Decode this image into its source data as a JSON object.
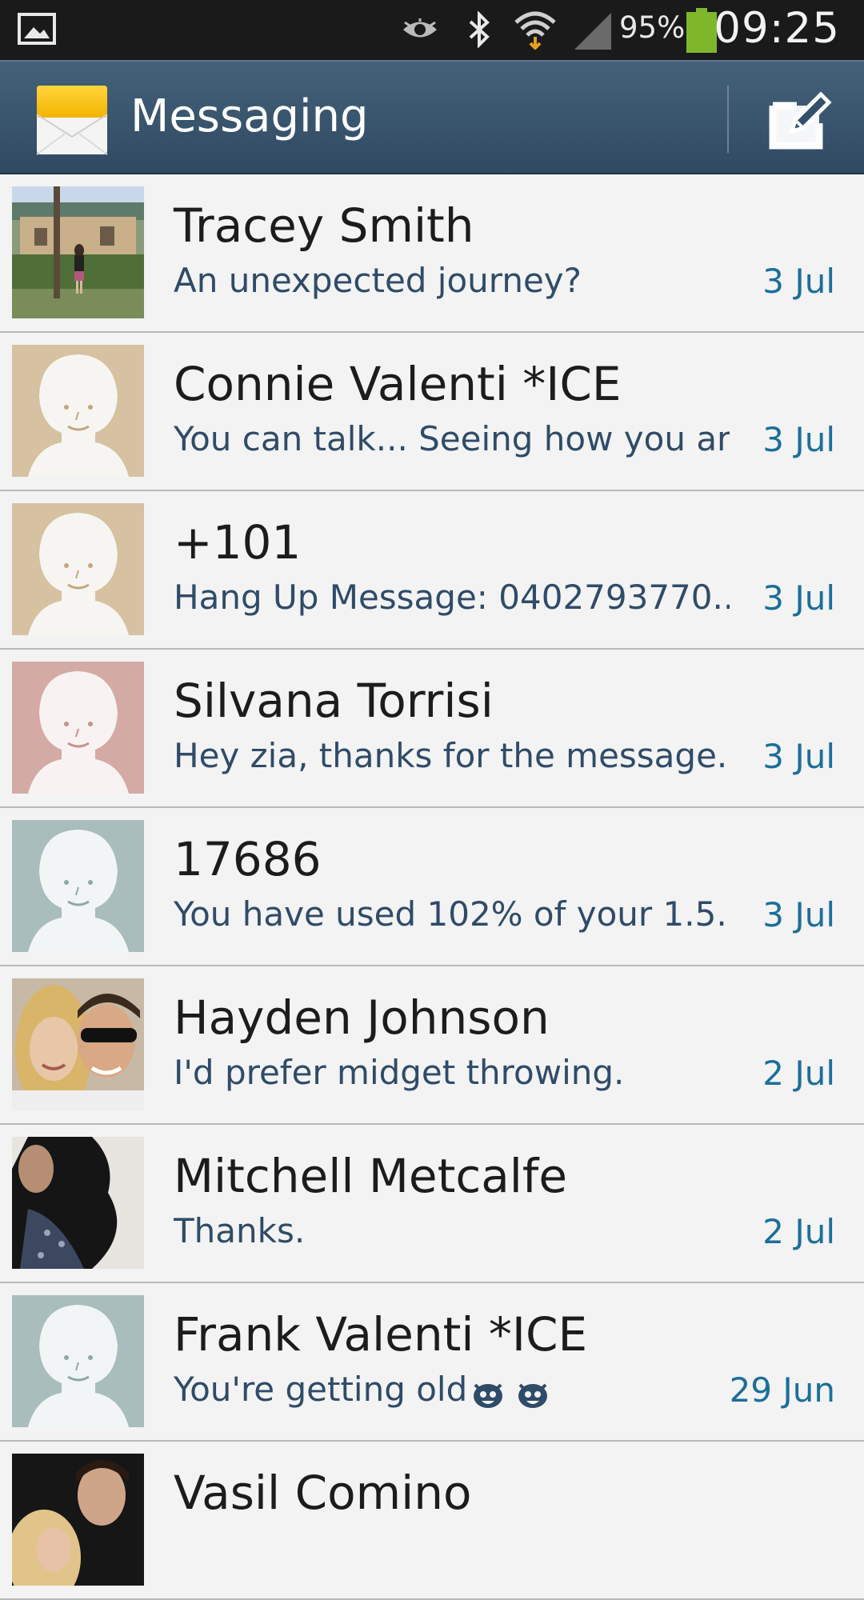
{
  "status_bar": {
    "battery_percent": "95%",
    "battery_level": 0.95,
    "time": "09:25",
    "icons": [
      "gallery-notification-icon",
      "eye-icon",
      "bluetooth-icon",
      "wifi-icon",
      "signal-icon",
      "battery-icon"
    ]
  },
  "action_bar": {
    "title": "Messaging",
    "app_icon": "envelope-icon",
    "compose_icon": "compose-icon"
  },
  "conversations": [
    {
      "name": "Tracey Smith",
      "preview": "An unexpected journey?",
      "date": "3 Jul",
      "avatar": "photo"
    },
    {
      "name": "Connie Valenti *ICE",
      "preview": "You can talk... Seeing how you ar...",
      "date": "3 Jul",
      "avatar": "default",
      "avatar_color": "#d6c1a1"
    },
    {
      "name": "+101",
      "preview": "Hang Up Message: 0402793770...",
      "date": "3 Jul",
      "avatar": "default",
      "avatar_color": "#d6c1a1"
    },
    {
      "name": "Silvana Torrisi",
      "preview": "Hey zia, thanks for the message....",
      "date": "3 Jul",
      "avatar": "default",
      "avatar_color": "#d3aaa4"
    },
    {
      "name": "17686",
      "preview": "You have used 102% of your 1.5...",
      "date": "3 Jul",
      "avatar": "default",
      "avatar_color": "#a8bdbc"
    },
    {
      "name": "Hayden Johnson",
      "preview": "I'd prefer midget throwing.",
      "date": "2 Jul",
      "avatar": "photo"
    },
    {
      "name": "Mitchell Metcalfe",
      "preview": "Thanks.",
      "date": "2 Jul",
      "avatar": "photo"
    },
    {
      "name": "Frank Valenti *ICE",
      "preview": "You're getting old",
      "date": "29 Jun",
      "avatar": "default",
      "avatar_color": "#a8bdbc",
      "preview_emoji": "android-emoji-icon"
    },
    {
      "name": "Vasil Comino",
      "preview": "",
      "date": "",
      "avatar": "photo"
    }
  ]
}
